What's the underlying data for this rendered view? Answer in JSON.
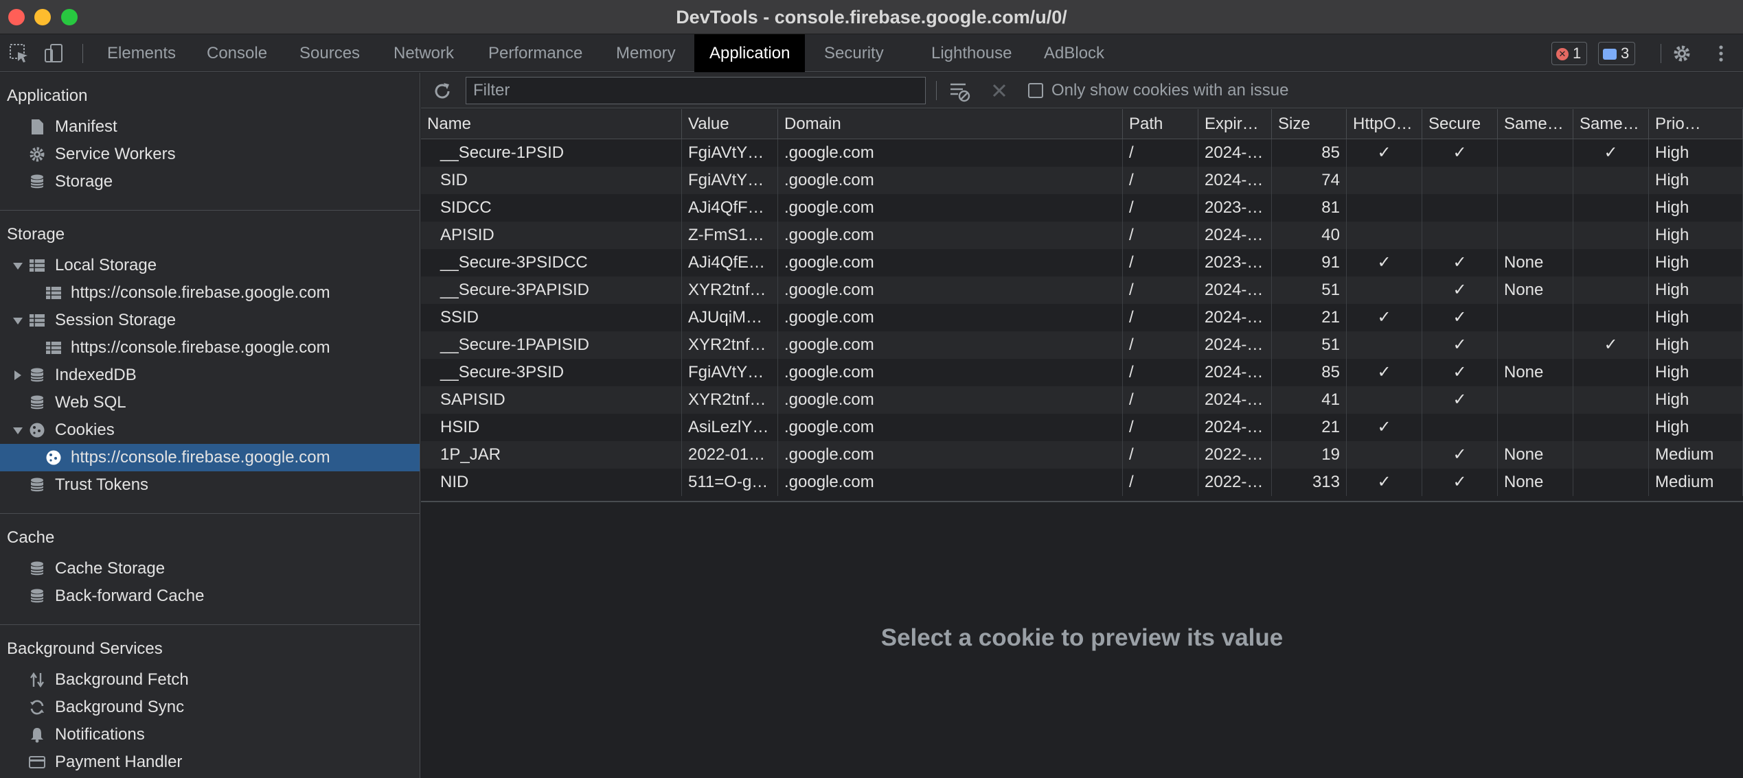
{
  "window": {
    "title": "DevTools - console.firebase.google.com/u/0/"
  },
  "tabs": [
    {
      "label": "Elements",
      "active": false
    },
    {
      "label": "Console",
      "active": false
    },
    {
      "label": "Sources",
      "active": false
    },
    {
      "label": "Network",
      "active": false
    },
    {
      "label": "Performance",
      "active": false
    },
    {
      "label": "Memory",
      "active": false
    },
    {
      "label": "Application",
      "active": true
    },
    {
      "label": "Security",
      "active": false
    },
    {
      "label": "Lighthouse",
      "active": false
    },
    {
      "label": "AdBlock",
      "active": false
    }
  ],
  "badges": {
    "errors": "1",
    "messages": "3"
  },
  "sidebar": {
    "application": {
      "heading": "Application",
      "items": [
        {
          "label": "Manifest",
          "icon": "file-icon"
        },
        {
          "label": "Service Workers",
          "icon": "gear-icon"
        },
        {
          "label": "Storage",
          "icon": "database-icon"
        }
      ]
    },
    "storage": {
      "heading": "Storage",
      "items": [
        {
          "label": "Local Storage",
          "icon": "grid-icon",
          "expanded": true
        },
        {
          "label": "https://console.firebase.google.com",
          "icon": "grid-icon"
        },
        {
          "label": "Session Storage",
          "icon": "grid-icon",
          "expanded": true
        },
        {
          "label": "https://console.firebase.google.com",
          "icon": "grid-icon"
        },
        {
          "label": "IndexedDB",
          "icon": "database-icon",
          "expanded": false
        },
        {
          "label": "Web SQL",
          "icon": "database-icon"
        },
        {
          "label": "Cookies",
          "icon": "cookie-icon",
          "expanded": true
        },
        {
          "label": "https://console.firebase.google.com",
          "icon": "cookie-icon",
          "selected": true
        },
        {
          "label": "Trust Tokens",
          "icon": "database-icon"
        }
      ]
    },
    "cache": {
      "heading": "Cache",
      "items": [
        {
          "label": "Cache Storage",
          "icon": "database-icon"
        },
        {
          "label": "Back-forward Cache",
          "icon": "database-icon"
        }
      ]
    },
    "background": {
      "heading": "Background Services",
      "items": [
        {
          "label": "Background Fetch",
          "icon": "arrows-up-down-icon"
        },
        {
          "label": "Background Sync",
          "icon": "sync-icon"
        },
        {
          "label": "Notifications",
          "icon": "bell-icon"
        },
        {
          "label": "Payment Handler",
          "icon": "card-icon"
        }
      ]
    }
  },
  "toolbar": {
    "filter_placeholder": "Filter",
    "only_issues_label": "Only show cookies with an issue"
  },
  "table": {
    "columns": [
      "Name",
      "Value",
      "Domain",
      "Path",
      "Expir…",
      "Size",
      "HttpO…",
      "Secure",
      "Same…",
      "Same…",
      "Prio…"
    ],
    "rows": [
      [
        "__Secure-1PSID",
        "FgiAVtY…",
        ".google.com",
        "/",
        "2024-…",
        "85",
        "✓",
        "✓",
        "",
        "✓",
        "High"
      ],
      [
        "SID",
        "FgiAVtY…",
        ".google.com",
        "/",
        "2024-…",
        "74",
        "",
        "",
        "",
        "",
        "High"
      ],
      [
        "SIDCC",
        "AJi4QfF…",
        ".google.com",
        "/",
        "2023-…",
        "81",
        "",
        "",
        "",
        "",
        "High"
      ],
      [
        "APISID",
        "Z-FmS1…",
        ".google.com",
        "/",
        "2024-…",
        "40",
        "",
        "",
        "",
        "",
        "High"
      ],
      [
        "__Secure-3PSIDCC",
        "AJi4QfE…",
        ".google.com",
        "/",
        "2023-…",
        "91",
        "✓",
        "✓",
        "None",
        "",
        "High"
      ],
      [
        "__Secure-3PAPISID",
        "XYR2tnf…",
        ".google.com",
        "/",
        "2024-…",
        "51",
        "",
        "✓",
        "None",
        "",
        "High"
      ],
      [
        "SSID",
        "AJUqiM…",
        ".google.com",
        "/",
        "2024-…",
        "21",
        "✓",
        "✓",
        "",
        "",
        "High"
      ],
      [
        "__Secure-1PAPISID",
        "XYR2tnf…",
        ".google.com",
        "/",
        "2024-…",
        "51",
        "",
        "✓",
        "",
        "✓",
        "High"
      ],
      [
        "__Secure-3PSID",
        "FgiAVtY…",
        ".google.com",
        "/",
        "2024-…",
        "85",
        "✓",
        "✓",
        "None",
        "",
        "High"
      ],
      [
        "SAPISID",
        "XYR2tnf…",
        ".google.com",
        "/",
        "2024-…",
        "41",
        "",
        "✓",
        "",
        "",
        "High"
      ],
      [
        "HSID",
        "AsiLezlY…",
        ".google.com",
        "/",
        "2024-…",
        "21",
        "✓",
        "",
        "",
        "",
        "High"
      ],
      [
        "1P_JAR",
        "2022-01…",
        ".google.com",
        "/",
        "2022-…",
        "19",
        "",
        "✓",
        "None",
        "",
        "Medium"
      ],
      [
        "NID",
        "511=O-g…",
        ".google.com",
        "/",
        "2022-…",
        "313",
        "✓",
        "✓",
        "None",
        "",
        "Medium"
      ]
    ]
  },
  "preview": {
    "message": "Select a cookie to preview its value"
  },
  "colors": {
    "accent": "#2b5a8c",
    "background": "#202124",
    "panel": "#292a2d"
  }
}
